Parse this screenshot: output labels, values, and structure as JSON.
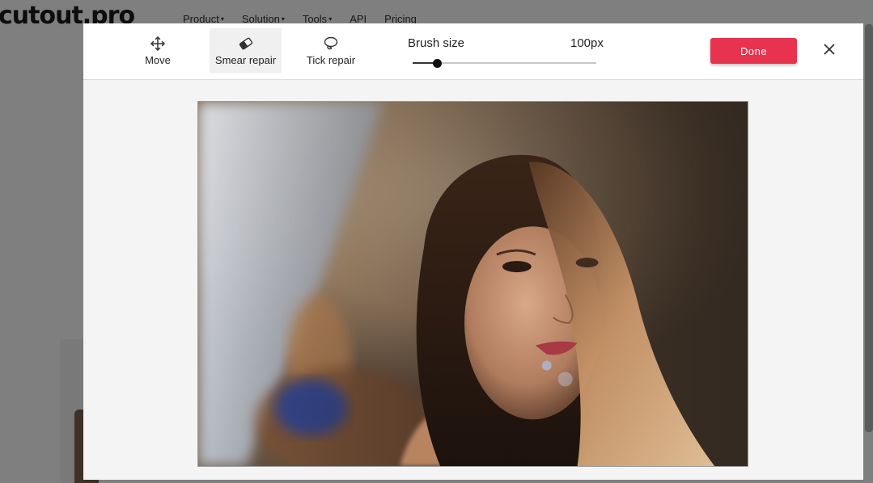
{
  "background": {
    "logo": "cutout.pro",
    "nav": [
      {
        "label": "Product",
        "caret": true
      },
      {
        "label": "Solution",
        "caret": true
      },
      {
        "label": "Tools",
        "caret": true
      },
      {
        "label": "API",
        "caret": false
      },
      {
        "label": "Pricing",
        "caret": false
      }
    ]
  },
  "toolbar": {
    "tools": [
      {
        "label": "Move",
        "icon": "move-arrows-icon",
        "active": false
      },
      {
        "label": "Smear repair",
        "icon": "eraser-icon",
        "active": true
      },
      {
        "label": "Tick repair",
        "icon": "lasso-icon",
        "active": false
      }
    ],
    "brush": {
      "label": "Brush size",
      "value_text": "100px",
      "level_fraction": 0.13
    },
    "done_label": "Done",
    "close_icon": "close-icon"
  },
  "colors": {
    "accent": "#e8334f",
    "overlay": "rgba(0,0,0,0.5)"
  }
}
